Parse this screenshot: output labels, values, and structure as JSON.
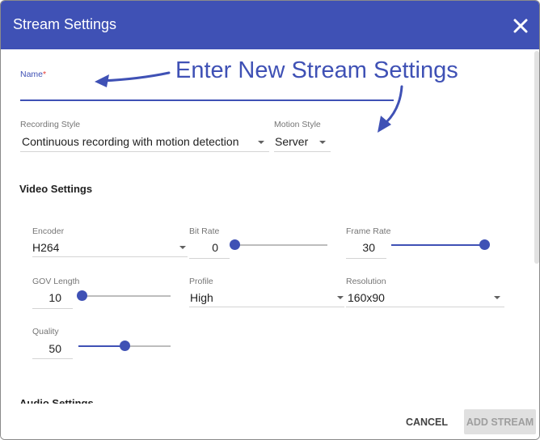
{
  "dialog": {
    "title": "Stream Settings",
    "accent_color": "#3f51b5"
  },
  "annotation": {
    "text": "Enter New Stream Settings"
  },
  "name_field": {
    "label": "Name",
    "required_marker": "*",
    "value": ""
  },
  "recording_style": {
    "label": "Recording Style",
    "value": "Continuous recording with motion detection"
  },
  "motion_style": {
    "label": "Motion Style",
    "value": "Server"
  },
  "video_settings": {
    "heading": "Video Settings",
    "encoder": {
      "label": "Encoder",
      "value": "H264"
    },
    "bit_rate": {
      "label": "Bit Rate",
      "value": "0",
      "slider_fraction": 0.0
    },
    "frame_rate": {
      "label": "Frame Rate",
      "value": "30",
      "slider_fraction": 1.0
    },
    "gov_length": {
      "label": "GOV Length",
      "value": "10",
      "slider_fraction": 0.0
    },
    "profile": {
      "label": "Profile",
      "value": "High"
    },
    "resolution": {
      "label": "Resolution",
      "value": "160x90"
    },
    "quality": {
      "label": "Quality",
      "value": "50",
      "slider_fraction": 0.5
    }
  },
  "audio_settings": {
    "heading": "Audio Settings"
  },
  "footer": {
    "cancel_label": "CANCEL",
    "add_label": "ADD STREAM"
  }
}
